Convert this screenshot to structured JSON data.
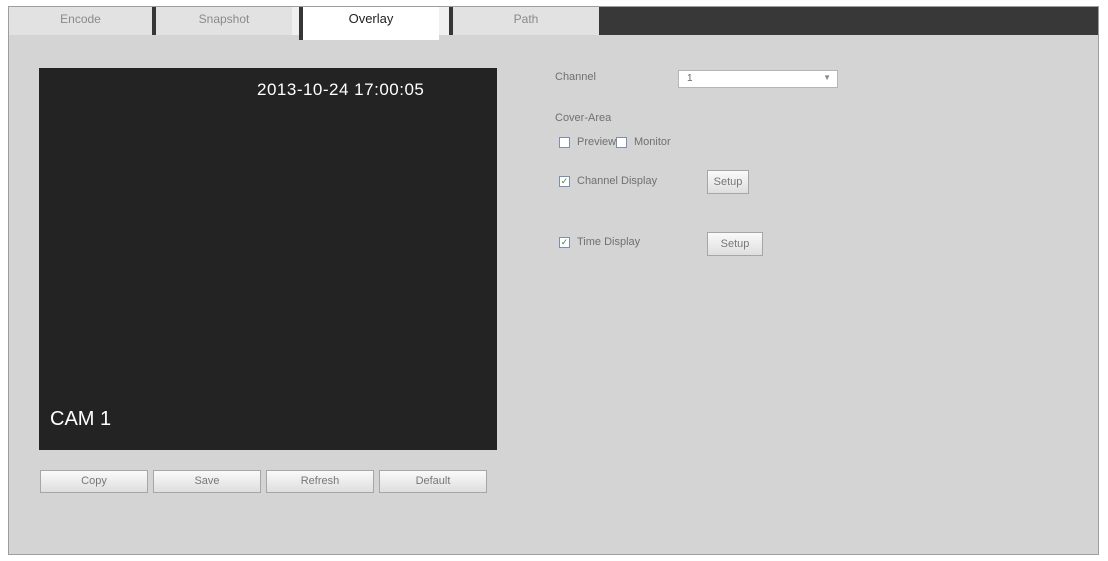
{
  "tabs": [
    {
      "label": "Encode",
      "active": false
    },
    {
      "label": "Snapshot",
      "active": false
    },
    {
      "label": "Overlay",
      "active": true
    },
    {
      "label": "Path",
      "active": false
    }
  ],
  "preview": {
    "timestamp": "2013-10-24 17:00:05",
    "camera_name": "CAM 1"
  },
  "buttons": {
    "copy": "Copy",
    "save": "Save",
    "refresh": "Refresh",
    "default": "Default"
  },
  "settings": {
    "channel_label": "Channel",
    "channel_value": "1",
    "cover_area_label": "Cover-Area",
    "preview_label": "Preview",
    "preview_checked": false,
    "monitor_label": "Monitor",
    "monitor_checked": false,
    "channel_display_label": "Channel Display",
    "channel_display_checked": true,
    "channel_display_setup": "Setup",
    "time_display_label": "Time Display",
    "time_display_checked": true,
    "time_display_setup": "Setup"
  },
  "icons": {
    "dropdown": "chevron-down-icon",
    "check": "checkmark"
  }
}
